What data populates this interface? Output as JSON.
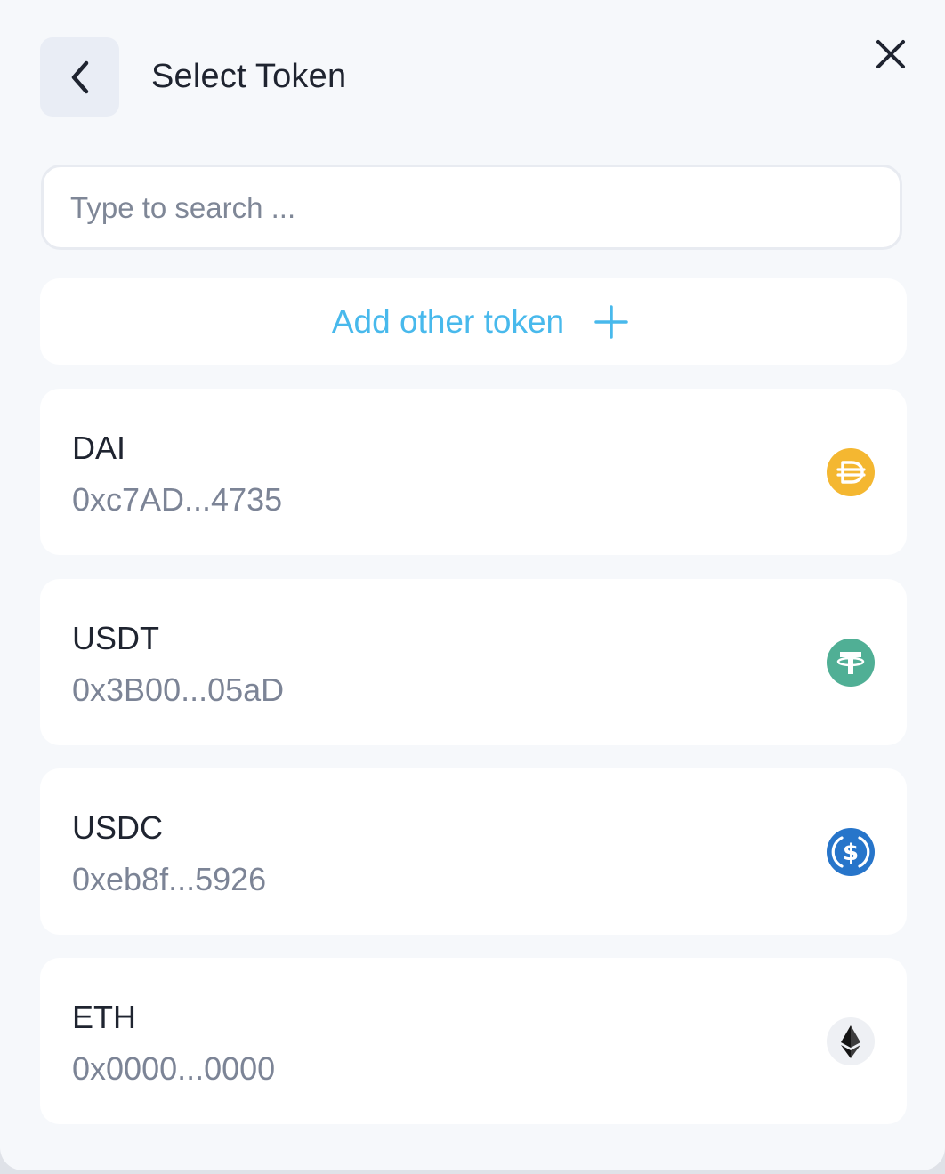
{
  "header": {
    "title": "Select Token",
    "back_icon": "chevron-left-icon",
    "close_icon": "close-icon"
  },
  "search": {
    "placeholder": "Type to search ...",
    "value": ""
  },
  "add_token": {
    "label": "Add other token",
    "icon": "plus-icon",
    "color": "#48b9ec"
  },
  "tokens": [
    {
      "symbol": "DAI",
      "address": "0xc7AD...4735",
      "icon": "dai-icon",
      "color": "#f4b731"
    },
    {
      "symbol": "USDT",
      "address": "0x3B00...05aD",
      "icon": "usdt-icon",
      "color": "#50af95"
    },
    {
      "symbol": "USDC",
      "address": "0xeb8f...5926",
      "icon": "usdc-icon",
      "color": "#2775ca"
    },
    {
      "symbol": "ETH",
      "address": "0x0000...0000",
      "icon": "eth-icon",
      "color": "#343434"
    }
  ]
}
